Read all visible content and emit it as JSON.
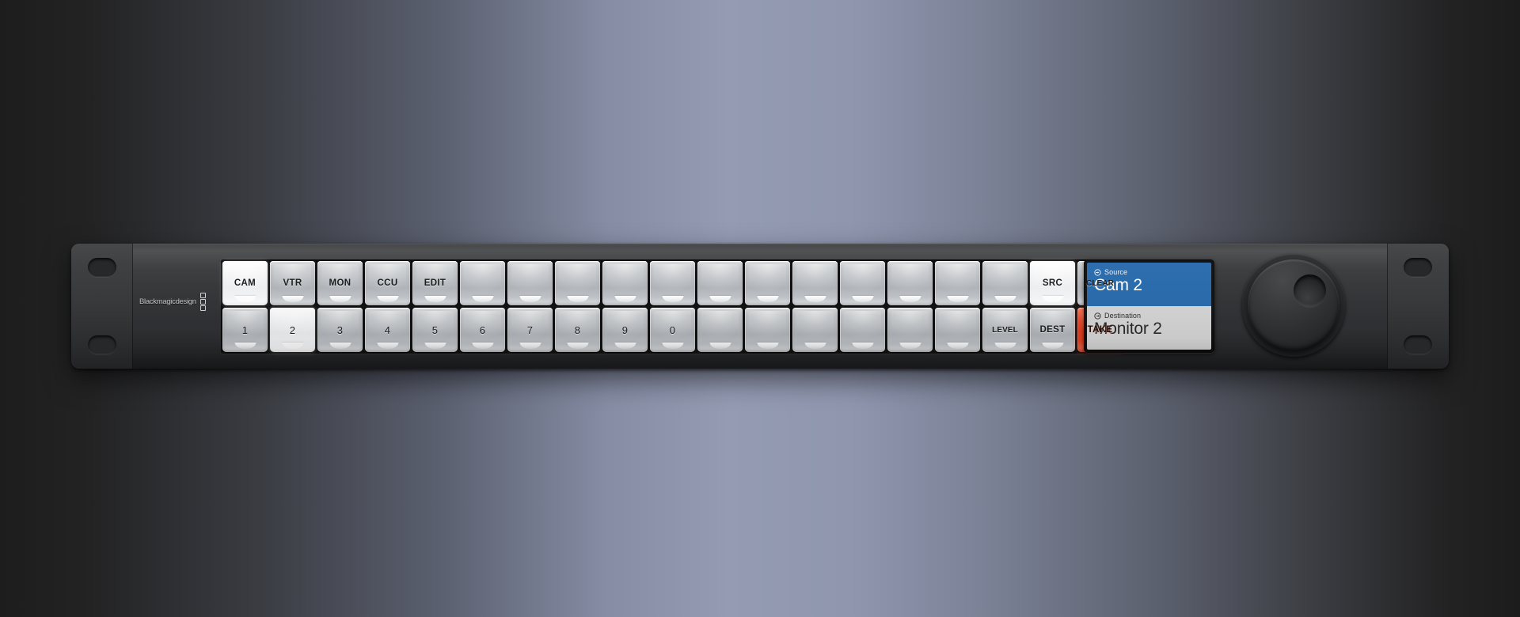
{
  "device": {
    "brand": "Blackmagicdesign",
    "accent_blue": "#2b6cad",
    "take_red": "#e8401e",
    "panel_dark": "#343538"
  },
  "button_grid": {
    "rows": [
      {
        "name": "top-row",
        "keys": [
          {
            "label": "CAM",
            "state": "lit"
          },
          {
            "label": "VTR",
            "state": "normal"
          },
          {
            "label": "MON",
            "state": "normal"
          },
          {
            "label": "CCU",
            "state": "normal"
          },
          {
            "label": "EDIT",
            "state": "normal"
          },
          {
            "label": "",
            "state": "normal"
          },
          {
            "label": "",
            "state": "normal"
          },
          {
            "label": "",
            "state": "normal"
          },
          {
            "label": "",
            "state": "normal"
          },
          {
            "label": "",
            "state": "normal"
          },
          {
            "label": "",
            "state": "normal"
          },
          {
            "label": "",
            "state": "normal"
          },
          {
            "label": "",
            "state": "normal"
          },
          {
            "label": "",
            "state": "normal"
          },
          {
            "label": "",
            "state": "normal"
          },
          {
            "label": "",
            "state": "normal"
          },
          {
            "label": "",
            "state": "normal"
          },
          {
            "label": "SRC",
            "state": "lit"
          },
          {
            "label": "CLEAR",
            "state": "normal"
          }
        ]
      },
      {
        "name": "bottom-row",
        "keys": [
          {
            "label": "1",
            "state": "normal"
          },
          {
            "label": "2",
            "state": "lit"
          },
          {
            "label": "3",
            "state": "normal"
          },
          {
            "label": "4",
            "state": "normal"
          },
          {
            "label": "5",
            "state": "normal"
          },
          {
            "label": "6",
            "state": "normal"
          },
          {
            "label": "7",
            "state": "normal"
          },
          {
            "label": "8",
            "state": "normal"
          },
          {
            "label": "9",
            "state": "normal"
          },
          {
            "label": "0",
            "state": "normal"
          },
          {
            "label": "",
            "state": "normal"
          },
          {
            "label": "",
            "state": "normal"
          },
          {
            "label": "",
            "state": "normal"
          },
          {
            "label": "",
            "state": "normal"
          },
          {
            "label": "",
            "state": "normal"
          },
          {
            "label": "",
            "state": "normal"
          },
          {
            "label": "LEVEL",
            "state": "normal"
          },
          {
            "label": "DEST",
            "state": "normal"
          },
          {
            "label": "TAKE",
            "state": "danger"
          }
        ]
      }
    ]
  },
  "lcd": {
    "source": {
      "icon": "input-arrow-icon",
      "caption": "Source",
      "value": "Cam 2"
    },
    "destination": {
      "icon": "output-arrow-icon",
      "caption": "Destination",
      "value": "Monitor 2"
    }
  },
  "knob": {
    "icon": "rotary-knob",
    "label": ""
  }
}
